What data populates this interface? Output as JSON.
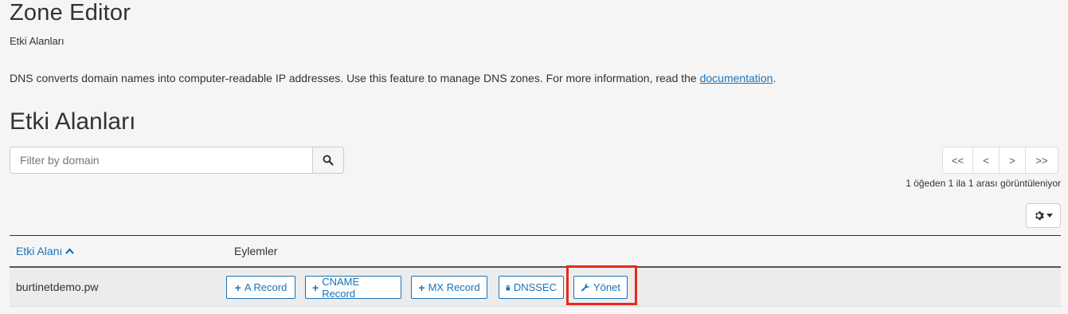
{
  "header": {
    "title": "Zone Editor",
    "breadcrumb": "Etki Alanları",
    "description_prefix": "DNS converts domain names into computer-readable IP addresses. Use this feature to manage DNS zones. For more information, read the ",
    "description_link": "documentation",
    "description_suffix": "."
  },
  "section": {
    "title": "Etki Alanları"
  },
  "search": {
    "placeholder": "Filter by domain",
    "value": "",
    "icon": "search-icon"
  },
  "pagination": {
    "first": "<<",
    "prev": "<",
    "next": ">",
    "last": ">>",
    "info": "1 öğeden 1 ila 1 arası görüntüleniyor"
  },
  "settings": {
    "icon": "gear-icon"
  },
  "table": {
    "columns": {
      "domain": "Etki Alanı",
      "actions": "Eylemler"
    },
    "rows": [
      {
        "domain": "burtinetdemo.pw",
        "actions": {
          "a_record": "A Record",
          "cname_record": "CNAME Record",
          "mx_record": "MX Record",
          "dnssec": "DNSSEC",
          "manage": "Yönet"
        }
      }
    ]
  },
  "colors": {
    "accent": "#1a73b8",
    "highlight": "#e8291d",
    "background": "#f5f5f5"
  }
}
